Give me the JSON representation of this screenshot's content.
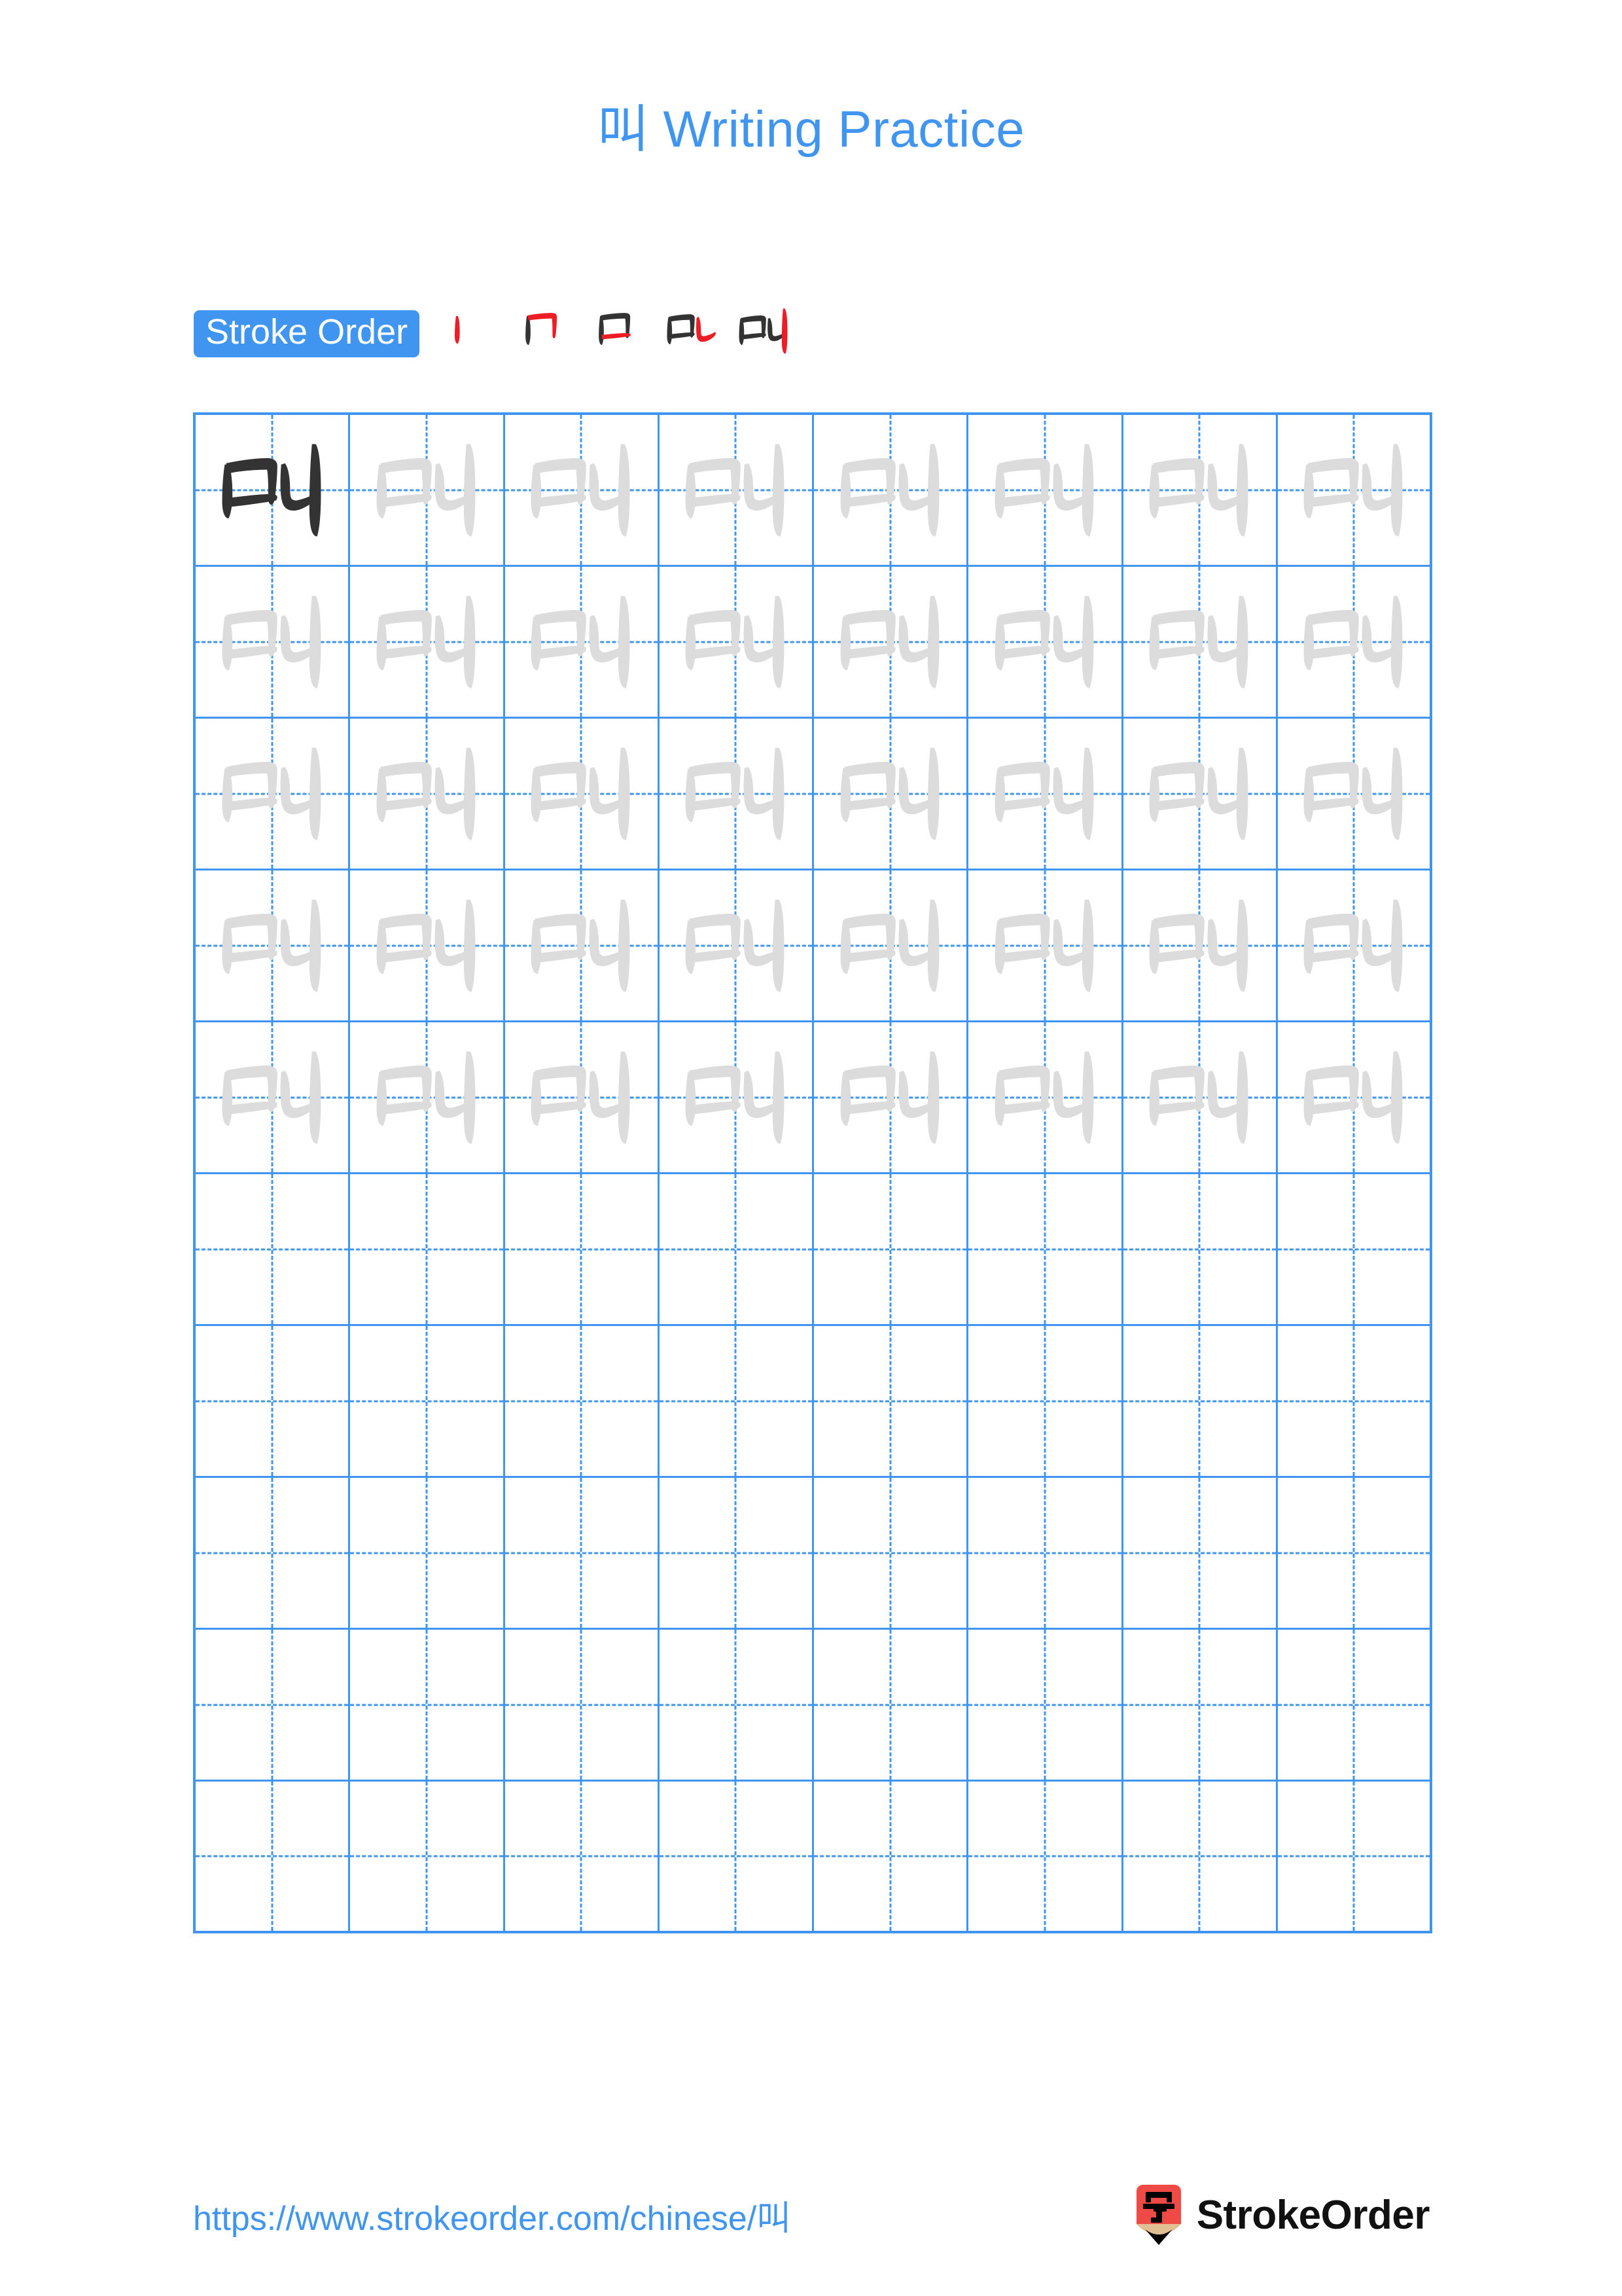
{
  "page": {
    "character": "叫",
    "title": "叫 Writing Practice",
    "accent_color": "#3f95ef",
    "stroke_new_color": "#ee1c25",
    "stroke_done_color": "#333333",
    "trace_color": "#dcdcdc",
    "model_color": "#333333"
  },
  "stroke_order": {
    "badge_label": "Stroke Order",
    "steps": [
      {
        "index": 1,
        "strokes_drawn": 1,
        "new_stroke": "vertical (丨)",
        "glyph": "丨"
      },
      {
        "index": 2,
        "strokes_drawn": 2,
        "new_stroke": "horizontal-turn-vertical (𠃍)",
        "glyph": "冂"
      },
      {
        "index": 3,
        "strokes_drawn": 3,
        "new_stroke": "bottom horizontal (一)",
        "glyph": "口"
      },
      {
        "index": 4,
        "strokes_drawn": 4,
        "new_stroke": "horizontal-bend-hook (乚)",
        "glyph": "口乚"
      },
      {
        "index": 5,
        "strokes_drawn": 5,
        "new_stroke": "long vertical (丨)",
        "glyph": "叫"
      }
    ],
    "total_strokes": 5
  },
  "grid": {
    "columns": 8,
    "rows": 10,
    "filled_rows": 5,
    "empty_rows": 5,
    "cells": [
      [
        "model",
        "trace",
        "trace",
        "trace",
        "trace",
        "trace",
        "trace",
        "trace"
      ],
      [
        "trace",
        "trace",
        "trace",
        "trace",
        "trace",
        "trace",
        "trace",
        "trace"
      ],
      [
        "trace",
        "trace",
        "trace",
        "trace",
        "trace",
        "trace",
        "trace",
        "trace"
      ],
      [
        "trace",
        "trace",
        "trace",
        "trace",
        "trace",
        "trace",
        "trace",
        "trace"
      ],
      [
        "trace",
        "trace",
        "trace",
        "trace",
        "trace",
        "trace",
        "trace",
        "trace"
      ],
      [
        "empty",
        "empty",
        "empty",
        "empty",
        "empty",
        "empty",
        "empty",
        "empty"
      ],
      [
        "empty",
        "empty",
        "empty",
        "empty",
        "empty",
        "empty",
        "empty",
        "empty"
      ],
      [
        "empty",
        "empty",
        "empty",
        "empty",
        "empty",
        "empty",
        "empty",
        "empty"
      ],
      [
        "empty",
        "empty",
        "empty",
        "empty",
        "empty",
        "empty",
        "empty",
        "empty"
      ],
      [
        "empty",
        "empty",
        "empty",
        "empty",
        "empty",
        "empty",
        "empty",
        "empty"
      ]
    ]
  },
  "footer": {
    "url": "https://www.strokeorder.com/chinese/叫",
    "brand_name": "StrokeOrder",
    "logo_character": "字",
    "logo_body_color": "#ef4a45",
    "logo_wood_color": "#e2bf93",
    "logo_tip_color": "#000000"
  }
}
